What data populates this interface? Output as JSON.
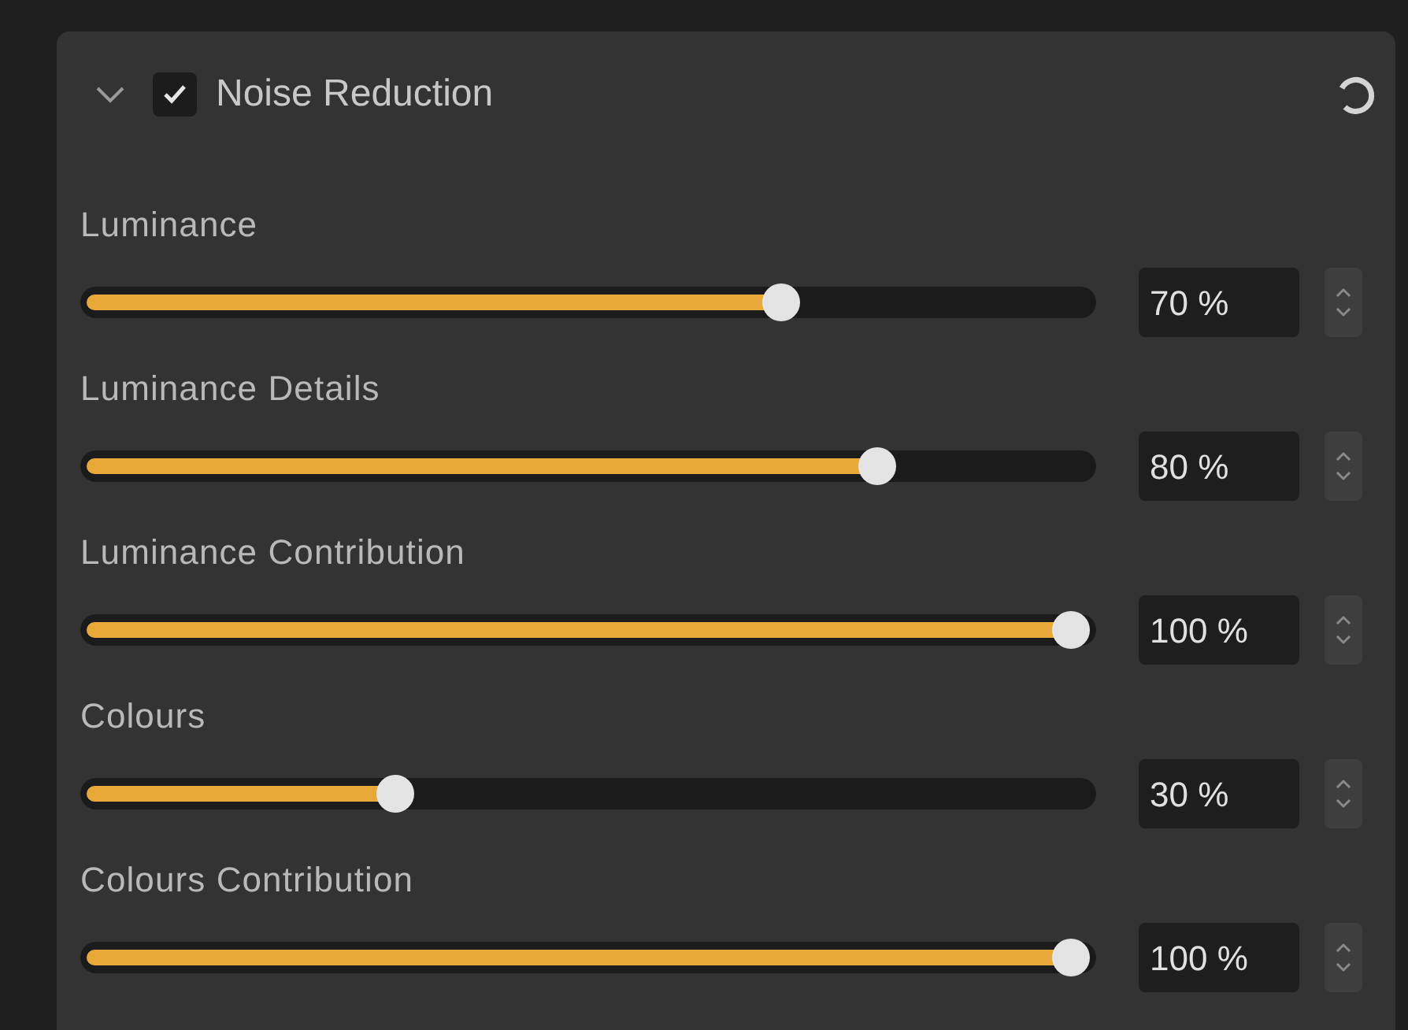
{
  "panel": {
    "title": "Noise Reduction",
    "expanded": true,
    "checked": true
  },
  "sliders": [
    {
      "label": "Luminance",
      "level": 0.7,
      "value": "70 %"
    },
    {
      "label": "Luminance Details",
      "level": 0.8,
      "value": "80 %"
    },
    {
      "label": "Luminance Contribution",
      "level": 1,
      "value": "100 %"
    },
    {
      "label": "Colours",
      "level": 0.3,
      "value": "30 %"
    },
    {
      "label": "Colours Contribution",
      "level": 1,
      "value": "100 %"
    }
  ]
}
